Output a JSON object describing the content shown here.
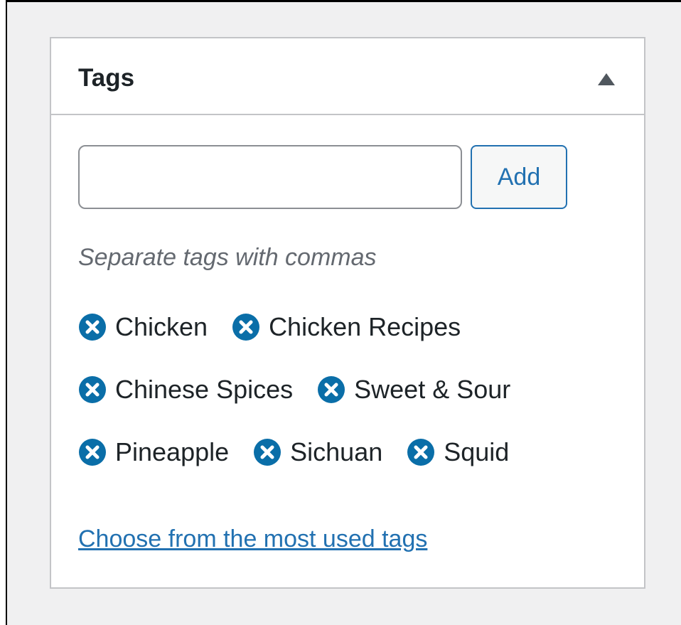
{
  "postbox": {
    "title": "Tags",
    "toggle_icon": "triangle-up-icon"
  },
  "tag_input": {
    "value": "",
    "placeholder": ""
  },
  "add_button": {
    "label": "Add"
  },
  "howto_text": "Separate tags with commas",
  "tags": {
    "rows": [
      [
        {
          "label": "Chicken"
        },
        {
          "label": "Chicken Recipes"
        }
      ],
      [
        {
          "label": "Chinese Spices"
        },
        {
          "label": "Sweet & Sour"
        }
      ],
      [
        {
          "label": "Pineapple"
        },
        {
          "label": "Sichuan"
        },
        {
          "label": "Squid"
        }
      ]
    ]
  },
  "most_used_link": {
    "label": "Choose from the most used tags"
  },
  "colors": {
    "accent": "#2271b1",
    "remove_icon": "#0a6ea8",
    "page_background": "#f0f0f1",
    "border": "#c3c4c7",
    "muted_text": "#646970"
  },
  "icons": {
    "remove_tag": "remove-circle-x-icon",
    "toggle": "triangle-up-icon"
  }
}
